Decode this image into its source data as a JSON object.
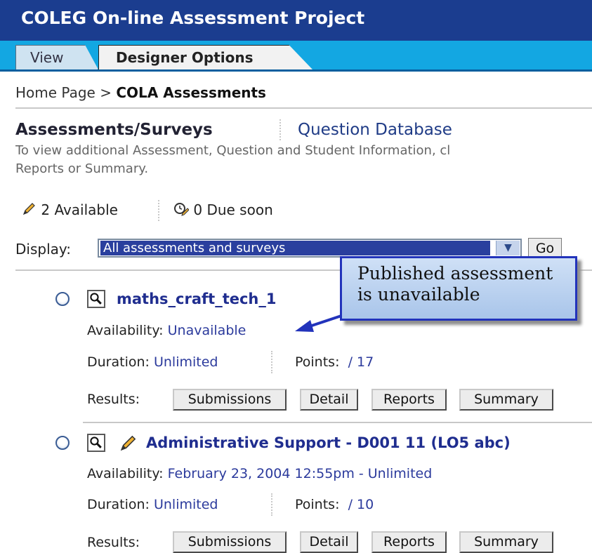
{
  "window": {
    "title": "COLEG On-line Assessment Project"
  },
  "tabs": [
    {
      "label": "View"
    },
    {
      "label": "Designer Options"
    }
  ],
  "breadcrumb": {
    "home": "Home Page",
    "separator": ">",
    "current": "COLA Assessments"
  },
  "section": {
    "title": "Assessments/Surveys",
    "link": "Question Database",
    "info_line1": "To view additional Assessment, Question and Student Information, cl",
    "info_line2": "Reports or Summary."
  },
  "stats": {
    "available": "2 Available",
    "due_soon": "0 Due soon"
  },
  "display": {
    "label": "Display:",
    "selected": "All assessments and surveys",
    "go": "Go"
  },
  "callout": {
    "line1": "Published assessment",
    "line2": "is unavailable"
  },
  "labels": {
    "availability": "Availability:",
    "duration": "Duration:",
    "points": "Points:",
    "results": "Results:"
  },
  "items": [
    {
      "title": "maths_craft_tech_1",
      "availability": "Unavailable",
      "duration": "Unlimited",
      "points": "/ 17",
      "buttons": [
        "Submissions",
        "Detail",
        "Reports",
        "Summary"
      ]
    },
    {
      "title": "Administrative Support - D001 11 (LO5 abc)",
      "availability": "February 23, 2004 12:55pm - Unlimited",
      "duration": "Unlimited",
      "points": "/ 10",
      "buttons": [
        "Submissions",
        "Detail",
        "Reports",
        "Summary"
      ]
    }
  ],
  "colors": {
    "title_bar": "#1b3d8f",
    "tab_bar": "#13a7e2",
    "link": "#1f2d8f",
    "callout_border": "#2233bb"
  }
}
